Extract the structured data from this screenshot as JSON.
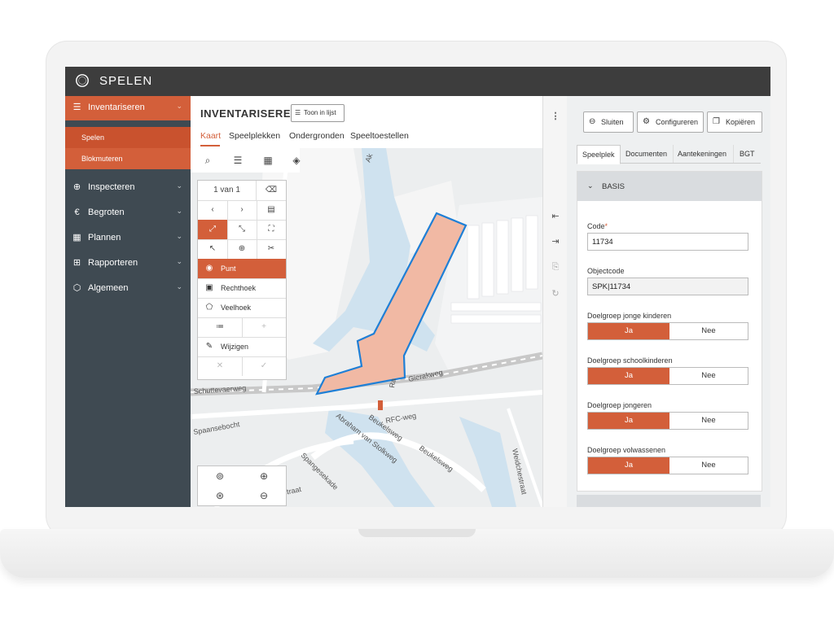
{
  "app": {
    "title": "SPELEN"
  },
  "sidebar": {
    "sections": [
      {
        "label": "Inventariseren",
        "icon": "list-icon",
        "active": true
      },
      {
        "label": "Inspecteren",
        "icon": "zoom-icon"
      },
      {
        "label": "Begroten",
        "icon": "euro-icon"
      },
      {
        "label": "Plannen",
        "icon": "calendar-icon"
      },
      {
        "label": "Rapporteren",
        "icon": "table-icon"
      },
      {
        "label": "Algemeen",
        "icon": "cube-icon"
      }
    ],
    "subitems": [
      "Spelen",
      "Blokmuteren"
    ]
  },
  "main": {
    "title": "INVENTARISEREN",
    "toon_button": "Toon in lijst",
    "tabs": [
      "Kaart",
      "Speelplekken",
      "Ondergronden",
      "Speeltoestellen"
    ]
  },
  "tool_panel": {
    "pager": "1 van 1",
    "draw_tools": [
      "Punt",
      "Rechthoek",
      "Veelhoek"
    ],
    "edit": "Wijzigen"
  },
  "map": {
    "labels": [
      "Schuttevaerweg",
      "Gierakweg",
      "RFC-weg",
      "Spaansebocht",
      "Abraham van Stolkweg",
      "Beukelsweg",
      "Spangesekade",
      "Weidchestraat",
      "ntstraat",
      "Ra",
      "Ak"
    ]
  },
  "right_panel": {
    "buttons": [
      "Sluiten",
      "Configureren",
      "Kopiëren"
    ],
    "tabs": [
      "Speelplek",
      "Documenten",
      "Aantekeningen",
      "BGT"
    ],
    "section": "BASIS",
    "code_label": "Code",
    "code_value": "11734",
    "objectcode_label": "Objectcode",
    "objectcode_value": "SPK|11734",
    "toggles": [
      {
        "label": "Doelgroep jonge kinderen",
        "yes": "Ja",
        "no": "Nee"
      },
      {
        "label": "Doelgroep schoolkinderen",
        "yes": "Ja",
        "no": "Nee"
      },
      {
        "label": "Doelgroep jongeren",
        "yes": "Ja",
        "no": "Nee"
      },
      {
        "label": "Doelgroep volwassenen",
        "yes": "Ja",
        "no": "Nee"
      }
    ]
  },
  "colors": {
    "accent": "#d35f3a",
    "dark": "#3d3d3d",
    "sidebar": "#3f4a52",
    "selection_fill": "#f1b9a4",
    "selection_stroke": "#1e7fd6"
  }
}
